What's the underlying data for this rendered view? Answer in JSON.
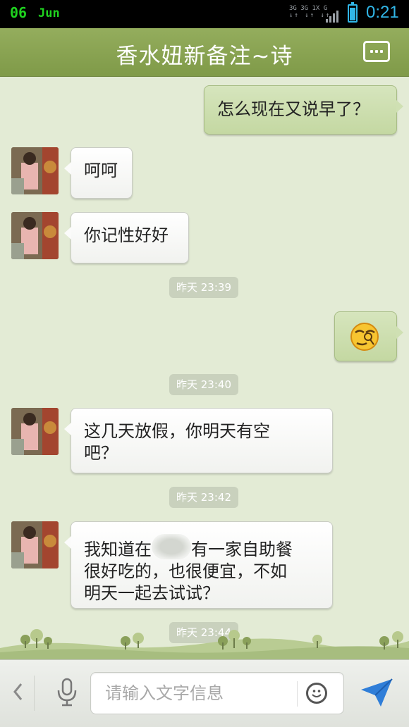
{
  "statusbar": {
    "date": "06",
    "month": "Jun",
    "net_top": "3G 3G 1X G",
    "time": "0:21"
  },
  "header": {
    "title": "香水妞新备注~诗"
  },
  "messages": [
    {
      "type": "out",
      "text": "怎么现在又说早了？"
    },
    {
      "type": "in",
      "text": "呵呵"
    },
    {
      "type": "in",
      "text": "你记性好好"
    },
    {
      "type": "time",
      "text": "昨天 23:39"
    },
    {
      "type": "out_emoji",
      "emoji": "smug-face-emoji"
    },
    {
      "type": "time",
      "text": "昨天 23:40"
    },
    {
      "type": "in",
      "line1": "这几天放假，你明天有空",
      "line2": "吧？"
    },
    {
      "type": "time",
      "text": "昨天 23:42"
    },
    {
      "type": "in",
      "part_a": "我知道在",
      "part_b": "有一家自助餐",
      "line2": "很好吃的，也很便宜，不如",
      "line3": "明天一起去试试？"
    },
    {
      "type": "time",
      "text": "昨天 23:44"
    }
  ],
  "input": {
    "placeholder": "请输入文字信息"
  },
  "colors": {
    "header": "#869f4e",
    "background": "#e3ebd5",
    "outgoing": "#cfe0b3",
    "incoming": "#ffffff",
    "send": "#2f7ed8"
  }
}
